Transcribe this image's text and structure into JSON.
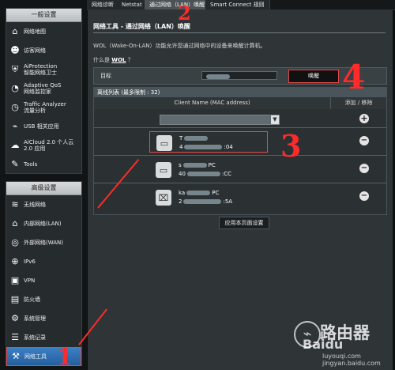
{
  "tabs": [
    "网络诊断",
    "Netstat",
    "通过网络（LAN）唤醒",
    "Smart Connect 规则"
  ],
  "sidebar": {
    "general_title": "一般设置",
    "general_items": [
      {
        "icon": "network-map-icon",
        "label1": "网络地图",
        "label2": ""
      },
      {
        "icon": "guest-network-icon",
        "label1": "访客网络",
        "label2": ""
      },
      {
        "icon": "aiprotection-icon",
        "label1": "AiProtection",
        "label2": "智能网络卫士"
      },
      {
        "icon": "qos-icon",
        "label1": "Adaptive QoS",
        "label2": "网络监控家"
      },
      {
        "icon": "traffic-analyzer-icon",
        "label1": "Traffic Analyzer",
        "label2": "流量分析"
      },
      {
        "icon": "usb-icon",
        "label1": "USB 相关应用",
        "label2": ""
      },
      {
        "icon": "aicloud-icon",
        "label1": "AiCloud 2.0 个人云",
        "label2": "2.0 应用"
      },
      {
        "icon": "tools-icon",
        "label1": "Tools",
        "label2": ""
      }
    ],
    "advanced_title": "高级设置",
    "advanced_items": [
      {
        "icon": "wireless-icon",
        "label": "无线网络"
      },
      {
        "icon": "lan-icon",
        "label": "内部网络(LAN)"
      },
      {
        "icon": "wan-icon",
        "label": "外部网络(WAN)"
      },
      {
        "icon": "ipv6-icon",
        "label": "IPv6"
      },
      {
        "icon": "vpn-icon",
        "label": "VPN"
      },
      {
        "icon": "firewall-icon",
        "label": "防火墙"
      },
      {
        "icon": "admin-icon",
        "label": "系统管理"
      },
      {
        "icon": "log-icon",
        "label": "系统记录"
      },
      {
        "icon": "network-tools-icon",
        "label": "网络工具"
      }
    ]
  },
  "main": {
    "title": "网络工具 - 通过网络（LAN）唤醒",
    "description": "WOL（Wake-On-LAN）功能允许您通过网络中的设备来唤醒计算机。",
    "link_prefix": "什么是",
    "link_text": "WOL",
    "link_suffix": "？",
    "target_label": "目标",
    "wake_label": "唤醒",
    "table_title": "离线列表 (最多限制 : 32)",
    "col_main": "Client Name (MAC address)",
    "col_side": "添加 / 移除",
    "devices": [
      {
        "name_prefix": "T",
        "mac_prefix": "4",
        "mac_suffix": ":04"
      },
      {
        "name_prefix": "s",
        "name_suffix": "PC",
        "mac_prefix": "40",
        "mac_suffix": ":CC"
      },
      {
        "name_prefix": "ka",
        "name_suffix": "PC",
        "mac_prefix": "2",
        "mac_suffix": ":5A"
      }
    ],
    "apply_label": "应用本页面设置"
  },
  "annotations": [
    "2",
    "4",
    "3",
    "1"
  ],
  "watermark": {
    "title": "路由器",
    "brand": "Baidu",
    "url": "luyouqi.com",
    "url2": "jingyan.baidu.com"
  },
  "colors": {
    "annotation": "#ff2a2a",
    "active_menu": "#2d6fb6"
  }
}
